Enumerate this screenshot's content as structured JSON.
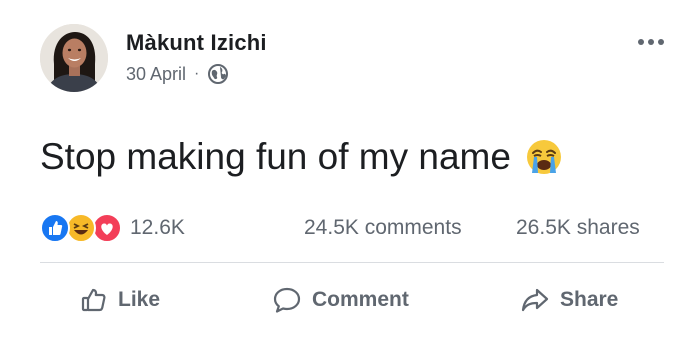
{
  "post": {
    "author_name": "Màkunt Izichi",
    "date": "30 April",
    "separator": "·",
    "privacy_icon": "globe-icon",
    "options_icon": "more-options-icon",
    "text": "Stop making fun of my name",
    "text_emoji": "crying-face-emoji"
  },
  "stats": {
    "reaction_icons": [
      "like-reaction-icon",
      "haha-reaction-icon",
      "love-reaction-icon"
    ],
    "reactions_count": "12.6K",
    "comments": "24.5K comments",
    "shares": "26.5K shares"
  },
  "actions": {
    "like_label": "Like",
    "comment_label": "Comment",
    "share_label": "Share"
  },
  "colors": {
    "like_blue": "#1877f2",
    "haha_yellow": "#f7b928",
    "love_red": "#f33e58",
    "secondary_text": "#606770",
    "primary_text": "#1c1e21",
    "divider": "#dadde1"
  }
}
